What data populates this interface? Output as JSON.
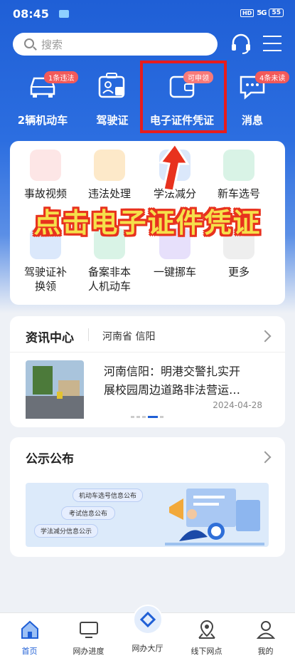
{
  "status": {
    "time": "08:45",
    "hd": "HD",
    "signal": "5G",
    "battery": "55"
  },
  "search": {
    "placeholder": "搜索"
  },
  "top_items": [
    {
      "label": "2辆机动车",
      "badge": "1条违法"
    },
    {
      "label": "驾驶证",
      "badge": ""
    },
    {
      "label": "电子证件凭证",
      "badge": "可申领"
    },
    {
      "label": "消息",
      "badge": "4条未读"
    }
  ],
  "services": [
    {
      "label": "事故视频",
      "label2": "",
      "color": "#fde6e6",
      "icon": "siren-icon"
    },
    {
      "label": "违法处理",
      "label2": "",
      "color": "#fde9c9",
      "icon": "violation-icon"
    },
    {
      "label": "学法减分",
      "label2": "",
      "color": "#dbe8fb",
      "icon": "study-icon"
    },
    {
      "label": "新车选号",
      "label2": "",
      "color": "#d9f3e6",
      "icon": "new-plate-icon"
    },
    {
      "label": "驾驶证补",
      "label2": "换领",
      "color": "#dbe8fb",
      "icon": "license-icon"
    },
    {
      "label": "备案非本",
      "label2": "人机动车",
      "color": "#d9f3e6",
      "icon": "record-icon"
    },
    {
      "label": "一键挪车",
      "label2": "",
      "color": "#e7e0fb",
      "icon": "move-car-icon"
    },
    {
      "label": "更多",
      "label2": "",
      "color": "#eeeeee",
      "icon": "more-icon"
    }
  ],
  "overlay": {
    "text": "点击电子证件凭证"
  },
  "news": {
    "title": "资讯中心",
    "region": "河南省 信阳",
    "headline_1": "河南信阳：明港交警扎实开",
    "headline_2": "展校园周边道路非法营运…",
    "date": "2024-04-28"
  },
  "notice": {
    "title": "公示公布",
    "tags": [
      "机动车选号信息公布",
      "考试信息公布",
      "学法减分信息公示"
    ]
  },
  "nav": [
    {
      "label": "首页",
      "active": true
    },
    {
      "label": "网办进度",
      "active": false
    },
    {
      "label": "网办大厅",
      "active": false
    },
    {
      "label": "线下网点",
      "active": false
    },
    {
      "label": "我的",
      "active": false
    }
  ],
  "colors": {
    "primary": "#1f5fd6",
    "accent_red": "#e81c1c",
    "overlay_yellow": "#f5e04a"
  }
}
